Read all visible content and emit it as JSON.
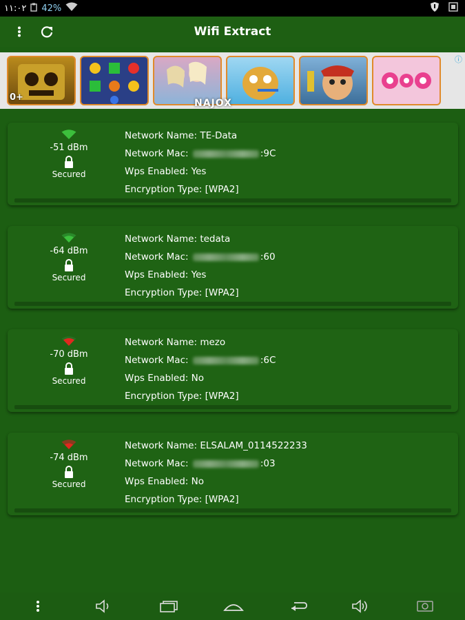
{
  "status_bar": {
    "time": "١١:٠٢",
    "battery_percent": "42%",
    "icons": [
      "clipboard-icon",
      "battery-icon",
      "wifi-signal-icon",
      "shield-icon",
      "screenshot-icon"
    ]
  },
  "app_bar": {
    "title": "Wifi Extract",
    "menu_icon": "more-vert-icon",
    "refresh_icon": "refresh-icon"
  },
  "ad": {
    "info_icon": "ⓘ",
    "age_rating": "0+",
    "brand": "NAJOX",
    "tiles": [
      "temple-run",
      "candy-crush",
      "frozen-princess",
      "talking-tom",
      "subway-surfers",
      "fidget-spinner"
    ]
  },
  "networks": [
    {
      "name_label": "Network Name: TE-Data",
      "mac_prefix": "Network Mac: ",
      "mac_suffix": ":9C",
      "wps_label": "Wps Enabled: Yes",
      "encryption_label": "Encryption Type: [WPA2]",
      "signal": "-51 dBm",
      "security": "Secured",
      "signal_color": "#3cbf3c",
      "signal_level": 4
    },
    {
      "name_label": "Network Name: tedata",
      "mac_prefix": "Network Mac: ",
      "mac_suffix": ":60",
      "wps_label": "Wps Enabled: Yes",
      "encryption_label": "Encryption Type: [WPA2]",
      "signal": "-64 dBm",
      "security": "Secured",
      "signal_color": "#3cbf3c",
      "signal_level": 3
    },
    {
      "name_label": "Network Name: mezo",
      "mac_prefix": "Network Mac: ",
      "mac_suffix": ":6C",
      "wps_label": "Wps Enabled: No",
      "encryption_label": "Encryption Type: [WPA2]",
      "signal": "-70 dBm",
      "security": "Secured",
      "signal_color": "#e0281e",
      "signal_level": 2
    },
    {
      "name_label": "Network Name: ELSALAM_0114522233",
      "mac_prefix": "Network Mac: ",
      "mac_suffix": ":03",
      "wps_label": "Wps Enabled: No",
      "encryption_label": "Encryption Type: [WPA2]",
      "signal": "-74 dBm",
      "security": "Secured",
      "signal_color": "#e0281e",
      "signal_level": 1
    }
  ],
  "nav_bar": {
    "icons": [
      "more-vert-icon",
      "volume-down-icon",
      "recent-apps-icon",
      "home-icon",
      "back-icon",
      "volume-up-icon",
      "screenshot-icon"
    ]
  }
}
